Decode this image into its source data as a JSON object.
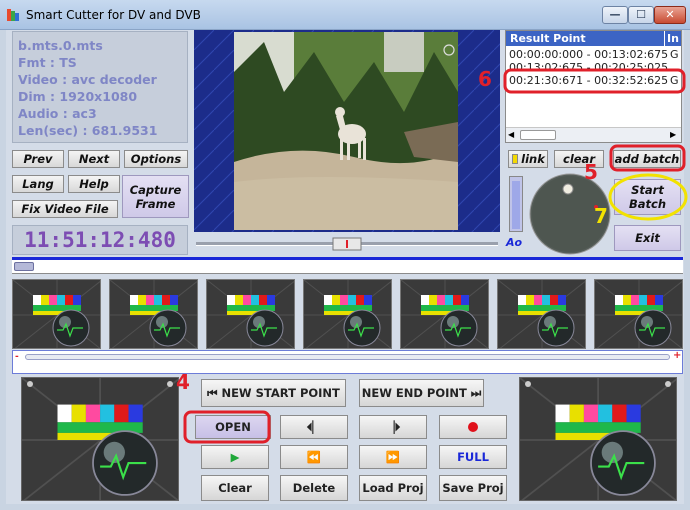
{
  "window": {
    "title": "Smart Cutter for DV and DVB",
    "min_glyph": "—",
    "max_glyph": "☐",
    "close_glyph": "✕"
  },
  "info": {
    "filename": "b.mts.0.mts",
    "format": "Fmt : TS",
    "video": "Video : avc decoder",
    "dim": "Dim : 1920x1080",
    "audio": "Audio : ac3",
    "length": "Len(sec) : 681.9531"
  },
  "nav_buttons": {
    "prev": "Prev",
    "next": "Next",
    "options": "Options",
    "lang": "Lang",
    "help": "Help",
    "capture": "Capture Frame",
    "fix": "Fix Video File"
  },
  "time_display": "11:51:12:480",
  "results": {
    "header_main": "Result Point",
    "header_extra": "In",
    "rows": [
      {
        "range": "00:00:00:000 - 00:13:02:675",
        "extra": "G"
      },
      {
        "range": "00:13:02:675 - 00:20:25:025",
        "extra": "G"
      },
      {
        "range": "00:21:30:671 - 00:32:52:625",
        "extra": "G"
      }
    ]
  },
  "batch": {
    "link": "link",
    "clear": "clear",
    "add_batch": "add batch",
    "start_batch": "Start Batch",
    "exit": "Exit",
    "ao": "Ao"
  },
  "controls": {
    "new_start": "NEW START POINT",
    "new_end": "NEW END POINT",
    "open": "OPEN",
    "full": "FULL",
    "clear": "Clear",
    "delete": "Delete",
    "load_proj": "Load Proj",
    "save_proj": "Save Proj"
  },
  "range_markers": {
    "left": "-",
    "right": "+"
  },
  "annotations": {
    "a4": "4",
    "a5": "5",
    "a6": "6",
    "a7": "7"
  },
  "colors": {
    "annotation_red": "#e0202a",
    "annotation_yellow": "#f2e200",
    "time_purple": "#7d4db3",
    "info_text": "#7f86c6"
  }
}
